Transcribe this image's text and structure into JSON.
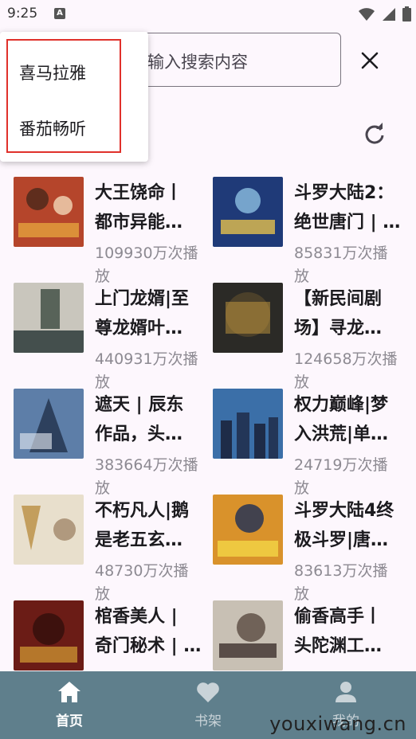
{
  "status_bar": {
    "time": "9:25",
    "notification_letter": "A"
  },
  "search": {
    "placeholder": "输入搜索内容"
  },
  "dropdown": {
    "items": [
      "喜马拉雅",
      "番茄畅听"
    ]
  },
  "books": [
    {
      "title_line1": "大王饶命丨",
      "title_line2": "都市异能…",
      "plays_line1": "109930万次播",
      "plays_line2": "放",
      "cover_color": "#b5452b"
    },
    {
      "title_line1": "斗罗大陆2：",
      "title_line2": "绝世唐门 | …",
      "plays_line1": "85831万次播",
      "plays_line2": "放",
      "cover_color": "#1f3a78"
    },
    {
      "title_line1": "上门龙婿|至",
      "title_line2": "尊龙婿叶…",
      "plays_line1": "440931万次播",
      "plays_line2": "放",
      "cover_color": "#c9c6bd"
    },
    {
      "title_line1": "【新民间剧",
      "title_line2": "场】寻龙…",
      "plays_line1": "124658万次播",
      "plays_line2": "放",
      "cover_color": "#2b2a26"
    },
    {
      "title_line1": "遮天 | 辰东",
      "title_line2": "作品，头…",
      "plays_line1": "383664万次播",
      "plays_line2": "放",
      "cover_color": "#5d7ea8"
    },
    {
      "title_line1": "权力巅峰|梦",
      "title_line2": "入洪荒|单…",
      "plays_line1": "24719万次播",
      "plays_line2": "放",
      "cover_color": "#3b6fa8"
    },
    {
      "title_line1": "不朽凡人|鹅",
      "title_line2": "是老五玄…",
      "plays_line1": "48730万次播",
      "plays_line2": "放",
      "cover_color": "#e8dfcc"
    },
    {
      "title_line1": "斗罗大陆4终",
      "title_line2": "极斗罗|唐…",
      "plays_line1": "83613万次播",
      "plays_line2": "放",
      "cover_color": "#d9922b"
    },
    {
      "title_line1": "棺香美人 |",
      "title_line2": "奇门秘术 | …",
      "plays_line1": "",
      "plays_line2": "",
      "cover_color": "#6b1c16"
    },
    {
      "title_line1": "偷香高手丨",
      "title_line2": "头陀渊工…",
      "plays_line1": "",
      "plays_line2": "",
      "cover_color": "#c8c0b4"
    }
  ],
  "nav": {
    "home": "首页",
    "shelf": "书架",
    "mine": "我的"
  },
  "watermark": "youxiwang.cn",
  "colors": {
    "background": "#fdf7fd",
    "nav_bg": "#5f7f8c",
    "dropdown_border": "#e0312b"
  }
}
